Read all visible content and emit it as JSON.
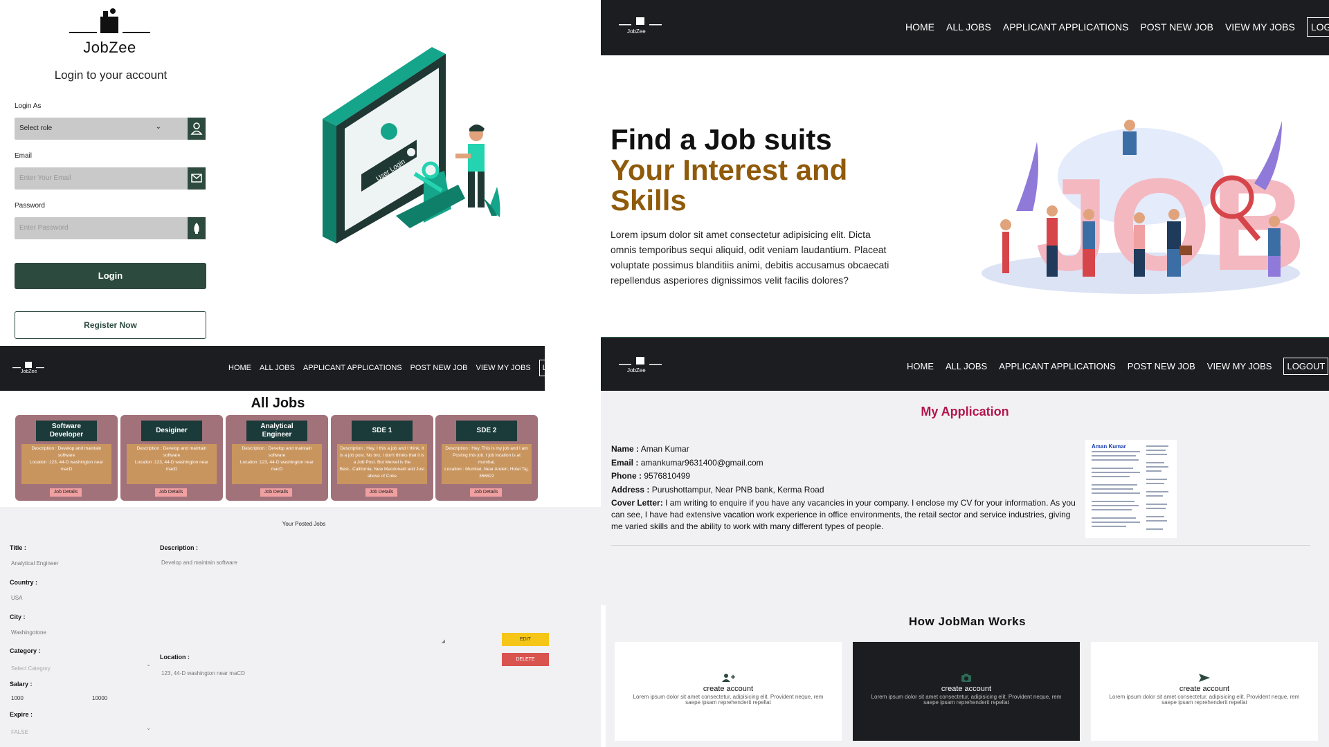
{
  "login": {
    "brand": "JobZee",
    "title": "Login to your account",
    "role_label": "Login As",
    "role_value": "Select role",
    "email_label": "Email",
    "email_placeholder": "Enter Your Email",
    "password_label": "Password",
    "password_placeholder": "Enter Password",
    "login_button": "Login",
    "register_button": "Register Now",
    "illustration_text": "User Login"
  },
  "nav": {
    "brand": "JobZee",
    "items": [
      "HOME",
      "ALL JOBS",
      "APPLICANT APPLICATIONS",
      "POST NEW JOB",
      "VIEW MY JOBS"
    ],
    "logout": "LOGOUT"
  },
  "hero": {
    "line1": "Find a Job suits",
    "line2": "Your Interest and Skills",
    "paragraph": "Lorem ipsum dolor sit amet consectetur adipisicing elit. Dicta omnis temporibus sequi aliquid, odit veniam laudantium. Placeat voluptate possimus blanditiis animi, debitis accusamus obcaecati repellendus asperiores dignissimos velit facilis dolores?",
    "illustration_text": "JOB"
  },
  "all_jobs": {
    "title": "All Jobs",
    "details_label": "Job Details",
    "jobs": [
      {
        "title": "Software Developer",
        "description": "Description : Develop and maintain software",
        "location": "Location :123, 44-D washington near macD"
      },
      {
        "title": "Desiginer",
        "description": "Description : Develop and maintain software",
        "location": "Location :123, 44-D washington near macD"
      },
      {
        "title": "Analytical Engineer",
        "description": "Description : Develop and maintain software",
        "location": "Location :123, 44-D washington near macD"
      },
      {
        "title": "SDE 1",
        "description": "Description : Hey, I this a job and I think, It is a job post. No bro, I don't thinks that it is a Job Post. But Mervel is the Best...California, New Macdonald and Just above of Coke",
        "location": ""
      },
      {
        "title": "SDE 2",
        "description": "Description : Hey, This is my job and I am Posting this job. I job location is at mumbai.",
        "location": "Location : Mumbai, Near Anderi, Hotel Taj, 366622"
      }
    ]
  },
  "posted": {
    "title": "Your Posted Jobs",
    "title_label": "Title :",
    "title_value": "Analytical Engineer",
    "country_label": "Country :",
    "country_value": "USA",
    "city_label": "City :",
    "city_value": "Washingotone",
    "category_label": "Category :",
    "category_value": "Select Category",
    "salary_label": "Salary :",
    "salary_from": "1000",
    "salary_to": "10000",
    "expire_label": "Expire :",
    "expire_value": "FALSE",
    "description_label": "Description :",
    "description_value": "Develop and maintain software",
    "location_label": "Location :",
    "location_value": "123, 44-D washington near maCD",
    "edit_button": "EDIT",
    "delete_button": "DELETE"
  },
  "my_application": {
    "title": "My Application",
    "name_label": "Name :",
    "name": "Aman Kumar",
    "email_label": "Email :",
    "email": "amankumar9631400@gmail.com",
    "phone_label": "Phone :",
    "phone": "9576810499",
    "address_label": "Address :",
    "address": "Purushottampur, Near PNB bank, Kerma Road",
    "cover_label": "Cover Letter:",
    "cover": "I am writing to enquire if you have any vacancies in your company. I enclose my CV for your information. As you can see, I have had extensive vacation work experience in office environments, the retail sector and service industries, giving me varied skills and the ability to work with many different types of people.",
    "resume_name": "Aman Kumar"
  },
  "how_it_works": {
    "title": "How JobMan Works",
    "cards": [
      {
        "title": "create account",
        "text": "Lorem ipsum dolor sit amet consectetur, adipisicing elit. Provident neque, rem saepe ipsam reprehenderit repellat",
        "theme": "light",
        "icon": "user-plus-icon"
      },
      {
        "title": "create account",
        "text": "Lorem ipsum dolor sit amet consectetur, adipisicing elit. Provident neque, rem saepe ipsam reprehenderit repellat",
        "theme": "dark",
        "icon": "camera-icon"
      },
      {
        "title": "create account",
        "text": "Lorem ipsum dolor sit amet consectetur, adipisicing elit. Provident neque, rem saepe ipsam reprehenderit repellat",
        "theme": "light",
        "icon": "send-icon"
      }
    ]
  },
  "colors": {
    "primary_green": "#2d4a3f",
    "navbar_bg": "#1b1d20",
    "hero_accent": "#8f5a0a",
    "job_card_bg": "#a2727b",
    "job_desc_bg": "#c9955f",
    "application_title": "#b3164a",
    "edit_button": "#f5c518",
    "delete_button": "#d9534f"
  }
}
